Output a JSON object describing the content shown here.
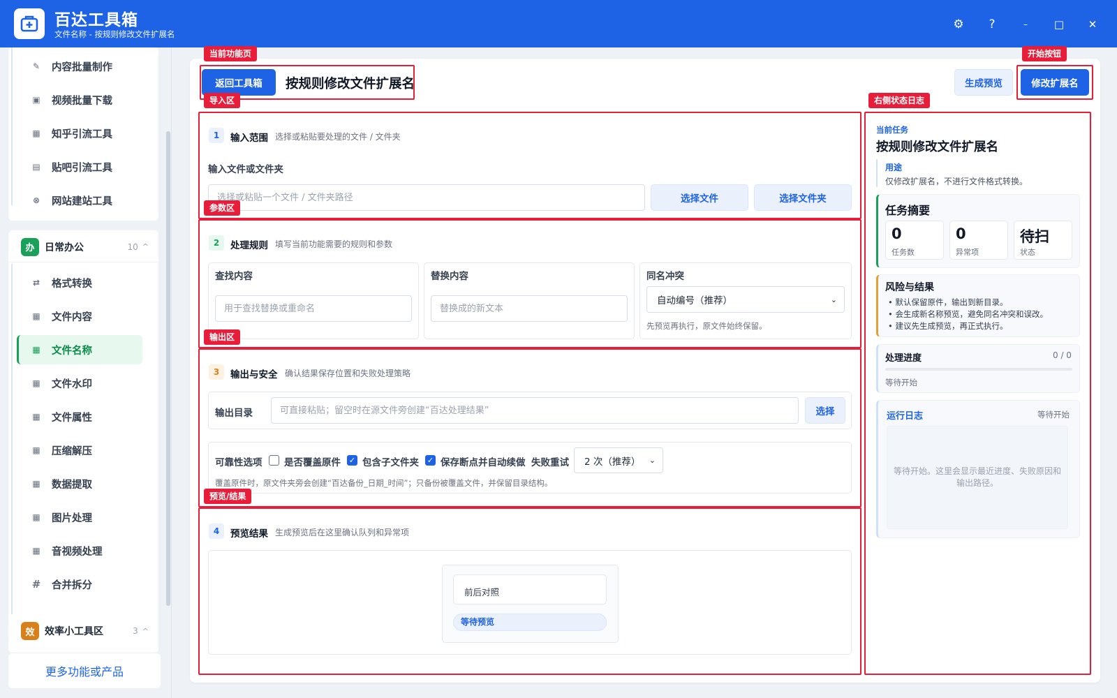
{
  "app": {
    "title": "百达工具箱",
    "subtitle": "文件名称 - 按规则修改文件扩展名",
    "controls": {
      "settings": "⚙",
      "help": "?",
      "minimize": "–",
      "maximize": "□",
      "close": "✕"
    }
  },
  "sidebar": {
    "top_items": [
      {
        "label": "内容批量制作",
        "icon": "✎"
      },
      {
        "label": "视频批量下载",
        "icon": "▣"
      },
      {
        "label": "知乎引流工具",
        "icon": "▦"
      },
      {
        "label": "贴吧引流工具",
        "icon": "▤"
      },
      {
        "label": "网站建站工具",
        "icon": "⊗"
      }
    ],
    "group_office": {
      "badge": "办",
      "title": "日常办公",
      "count": "10",
      "caret": "^",
      "items": [
        {
          "label": "格式转换",
          "icon": "⇄"
        },
        {
          "label": "文件内容",
          "icon": "▦"
        },
        {
          "label": "文件名称",
          "icon": "▦"
        },
        {
          "label": "文件水印",
          "icon": "▦"
        },
        {
          "label": "文件属性",
          "icon": "▦"
        },
        {
          "label": "压缩解压",
          "icon": "▦"
        },
        {
          "label": "数据提取",
          "icon": "▦"
        },
        {
          "label": "图片处理",
          "icon": "▦"
        },
        {
          "label": "音视频处理",
          "icon": "▦"
        },
        {
          "label": "合并拆分",
          "icon": "#"
        }
      ]
    },
    "group_efficiency": {
      "badge": "效",
      "title": "效率小工具区",
      "count": "3",
      "caret": "^"
    },
    "more_button": "更多功能或产品"
  },
  "toolbar": {
    "back_button": "返回工具箱",
    "page_title": "按规则修改文件扩展名",
    "preview_button": "生成预览",
    "start_button": "修改扩展名"
  },
  "annotations": {
    "current_page": "当前功能页",
    "start_button": "开始按钮",
    "import_area": "导入区",
    "right_log": "右侧状态日志",
    "param_area": "参数区",
    "output_area": "输出区",
    "preview_area": "预览/结果"
  },
  "section_input": {
    "num": "1",
    "title": "输入范围",
    "desc": "选择或粘贴要处理的文件 / 文件夹",
    "field_label": "输入文件或文件夹",
    "placeholder": "选择或粘贴一个文件 / 文件夹路径",
    "choose_file": "选择文件",
    "choose_folder": "选择文件夹"
  },
  "section_rules": {
    "num": "2",
    "title": "处理规则",
    "desc": "填写当前功能需要的规则和参数",
    "find_label": "查找内容",
    "find_placeholder": "用于查找替换或重命名",
    "replace_label": "替换内容",
    "replace_placeholder": "替换成的新文本",
    "conflict_label": "同名冲突",
    "conflict_value": "自动编号（推荐）",
    "conflict_hint": "先预览再执行，原文件始终保留。"
  },
  "section_output": {
    "num": "3",
    "title": "输出与安全",
    "desc": "确认结果保存位置和失败处理策略",
    "dir_label": "输出目录",
    "dir_placeholder": "可直接粘贴；留空时在源文件旁创建“百达处理结果”",
    "choose": "选择",
    "reliability_label": "可靠性选项",
    "overwrite_label": "是否覆盖原件",
    "subfolders_label": "包含子文件夹",
    "resume_label": "保存断点并自动续做",
    "retry_label": "失败重试",
    "retry_value": "2 次（推荐）",
    "hint": "覆盖原件时，原文件夹旁会创建“百达备份_日期_时间”；只备份被覆盖文件，并保留目录结构。"
  },
  "section_preview": {
    "num": "4",
    "title": "预览结果",
    "desc": "生成预览后在这里确认队列和异常项",
    "compare_label": "前后对照",
    "waiting_badge": "等待预览"
  },
  "right_panel": {
    "current_task_label": "当前任务",
    "task_title": "按规则修改文件扩展名",
    "purpose_label": "用途",
    "purpose_text": "仅修改扩展名，不进行文件格式转换。",
    "summary_title": "任务摘要",
    "stats": [
      {
        "value": "0",
        "label": "任务数"
      },
      {
        "value": "0",
        "label": "异常项"
      },
      {
        "value": "待扫",
        "label": "状态"
      }
    ],
    "risk_title": "风险与结果",
    "risk_items": [
      "默认保留原件，输出到新目录。",
      "会生成新名称预览，避免同名冲突和误改。",
      "建议先生成预览，再正式执行。"
    ],
    "progress_title": "处理进度",
    "progress_value": "0 / 0",
    "progress_fraction": 0,
    "progress_status": "等待开始",
    "log_title": "运行日志",
    "log_status": "等待开始",
    "log_placeholder": "等待开始。这里会显示最近进度、失败原因和输出路径。"
  },
  "colors": {
    "brand": "#1e63e6",
    "annotation": "#e81d3a",
    "active_green": "#19a05a",
    "office_badge": "#19a05a",
    "efficiency_badge": "#d9801a"
  }
}
